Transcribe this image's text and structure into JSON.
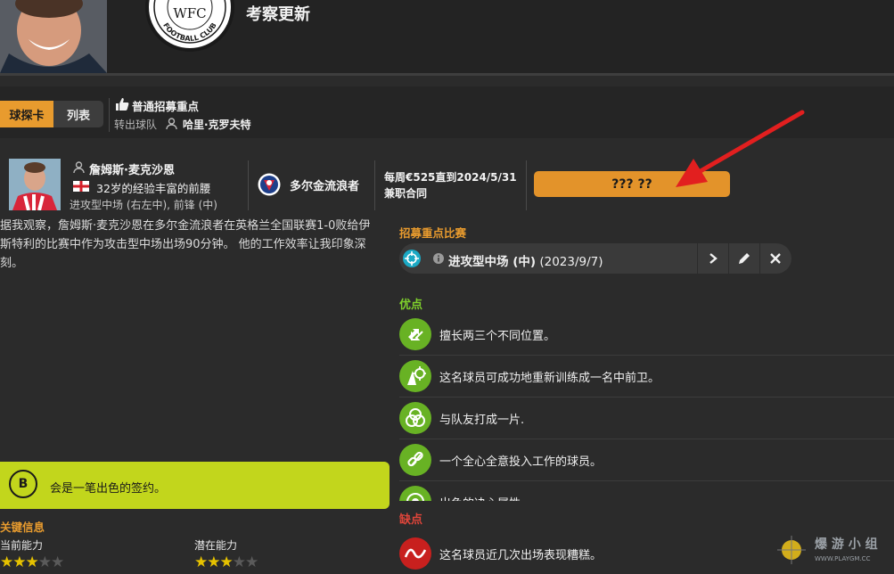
{
  "header": {
    "title": "考察更新",
    "badge_text": "FOOTBALL CLUB",
    "badge_monogram": "WFC"
  },
  "tabs": [
    {
      "label": "球探卡",
      "active": true
    },
    {
      "label": "列表",
      "active": false
    }
  ],
  "recruitment": {
    "focus_label": "普通招募重点",
    "transfer_label": "转出球队",
    "transfer_name": "哈里·克罗夫特"
  },
  "player": {
    "name": "詹姆斯·麦克沙恩",
    "description": "32岁的经验丰富的前腰",
    "positions": "进攻型中场 (右左中), 前锋 (中)",
    "club": "多尔金流浪者",
    "contract_line1": "每周€525直到2024/5/31",
    "contract_line2": "兼职合同",
    "action_button": "??? ??"
  },
  "report": {
    "text": "据我观察，詹姆斯·麦克沙恩在多尔金流浪者在英格兰全国联赛1-0败给伊斯特利的比赛中作为攻击型中场出场90分钟。 他的工作效率让我印象深刻。"
  },
  "grade": {
    "letter": "B",
    "text": "会是一笔出色的签约。"
  },
  "key_info": {
    "title": "关键信息",
    "current_ability_label": "当前能力",
    "potential_ability_label": "潜在能力",
    "current_stars": 3,
    "potential_stars": 3,
    "max_stars": 5
  },
  "match": {
    "title": "招募重点比赛",
    "position_bold": "进攻型中场 (中)",
    "date": "(2023/9/7)"
  },
  "strengths": {
    "title": "优点",
    "items": [
      {
        "text": "擅长两三个不同位置。",
        "icon": "swap-arrows-icon"
      },
      {
        "text": "这名球员可成功地重新训练成一名中前卫。",
        "icon": "retrain-cone-icon"
      },
      {
        "text": "与队友打成一片.",
        "icon": "circles-icon"
      },
      {
        "text": "一个全心全意投入工作的球员。",
        "icon": "chain-icon"
      },
      {
        "text": "出色的决心属性",
        "icon": "target-icon"
      }
    ]
  },
  "weaknesses": {
    "title": "缺点",
    "items": [
      {
        "text": "这名球员近几次出场表现糟糕。",
        "icon": "downtrend-icon"
      }
    ]
  },
  "watermark": {
    "text": "爆 游 小 组",
    "url": "WWW.PLAYGM.CC"
  },
  "colors": {
    "accent_orange": "#e89b2e",
    "strength_green": "#68b224",
    "weakness_red": "#c8201e",
    "grade_yellow_green": "#c2d61c"
  }
}
